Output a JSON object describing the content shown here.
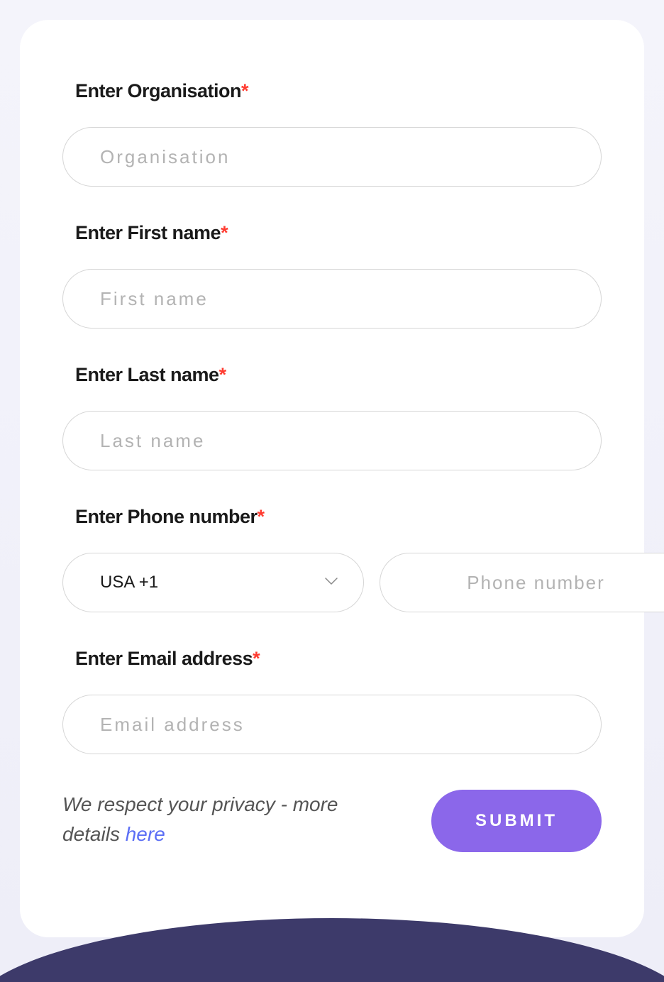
{
  "form": {
    "organisation": {
      "label": "Enter Organisation",
      "placeholder": "Organisation"
    },
    "firstname": {
      "label": "Enter First name",
      "placeholder": "First name"
    },
    "lastname": {
      "label": "Enter Last name",
      "placeholder": "Last name"
    },
    "phone": {
      "label": "Enter Phone number",
      "country_value": "USA +1",
      "placeholder": "Phone number"
    },
    "email": {
      "label": "Enter Email address",
      "placeholder": "Email address"
    }
  },
  "footer": {
    "privacy_text_before": "We respect your privacy - more details ",
    "privacy_link_text": "here",
    "submit_label": "SUBMIT"
  },
  "required_marker": "*"
}
